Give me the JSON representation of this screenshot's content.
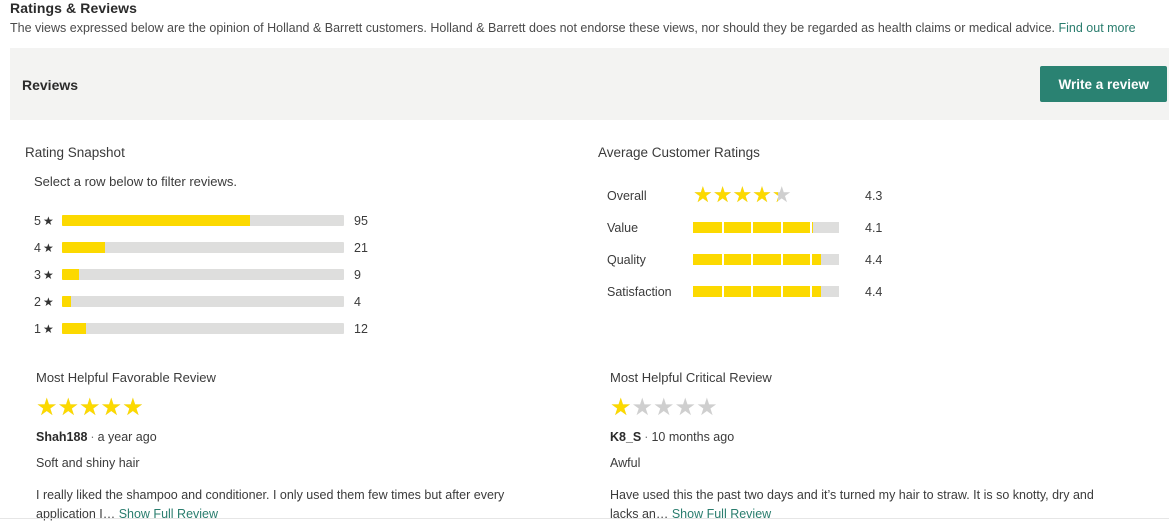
{
  "header": {
    "title": "Ratings & Reviews",
    "disclaimer": "The views expressed below are the opinion of Holland & Barrett customers. Holland & Barrett does not endorse these views, nor should they be regarded as health claims or medical advice.",
    "disclaimer_link": "Find out more"
  },
  "reviews_bar": {
    "label": "Reviews",
    "write_review_label": "Write a review",
    "button_color": "#2a8272"
  },
  "snapshot": {
    "heading": "Rating Snapshot",
    "subtext": "Select a row below to filter reviews.",
    "rows": [
      {
        "stars": "5",
        "star_glyph": "★",
        "count": "95",
        "percent": 66.7
      },
      {
        "stars": "4",
        "star_glyph": "★",
        "count": "21",
        "percent": 15.2
      },
      {
        "stars": "3",
        "star_glyph": "★",
        "count": "9",
        "percent": 6.0
      },
      {
        "stars": "2",
        "star_glyph": "★",
        "count": "4",
        "percent": 3.2
      },
      {
        "stars": "1",
        "star_glyph": "★",
        "count": "12",
        "percent": 8.5
      }
    ]
  },
  "average_ratings": {
    "heading": "Average Customer Ratings",
    "rows": [
      {
        "name": "Overall",
        "value": "4.3",
        "percent": 86,
        "display": "stars"
      },
      {
        "name": "Value",
        "value": "4.1",
        "percent": 82,
        "display": "bar"
      },
      {
        "name": "Quality",
        "value": "4.4",
        "percent": 88,
        "display": "bar"
      },
      {
        "name": "Satisfaction",
        "value": "4.4",
        "percent": 88,
        "display": "bar"
      }
    ]
  },
  "favorable_review": {
    "heading": "Most Helpful Favorable Review",
    "rating_percent": 100,
    "author": "Shah188",
    "separator": "·",
    "age": "a year ago",
    "title": "Soft and shiny hair",
    "body": "I really liked the shampoo and conditioner. I only used them few times but after every application I… ",
    "show_full": "Show Full Review"
  },
  "critical_review": {
    "heading": "Most Helpful Critical Review",
    "rating_percent": 20,
    "author": "K8_S",
    "separator": "·",
    "age": "10 months ago",
    "title": "Awful",
    "body": "Have used this the past two days and it’s turned my hair to straw. It is so knotty, dry and lacks an… ",
    "show_full": "Show Full Review"
  },
  "colors": {
    "star_yellow": "#fcd900",
    "track_gray": "#dededd",
    "link_green": "#2a7d6e",
    "panel_gray": "#f3f3f2"
  },
  "icons": {
    "star": "★",
    "five_stars": "★★★★★"
  }
}
